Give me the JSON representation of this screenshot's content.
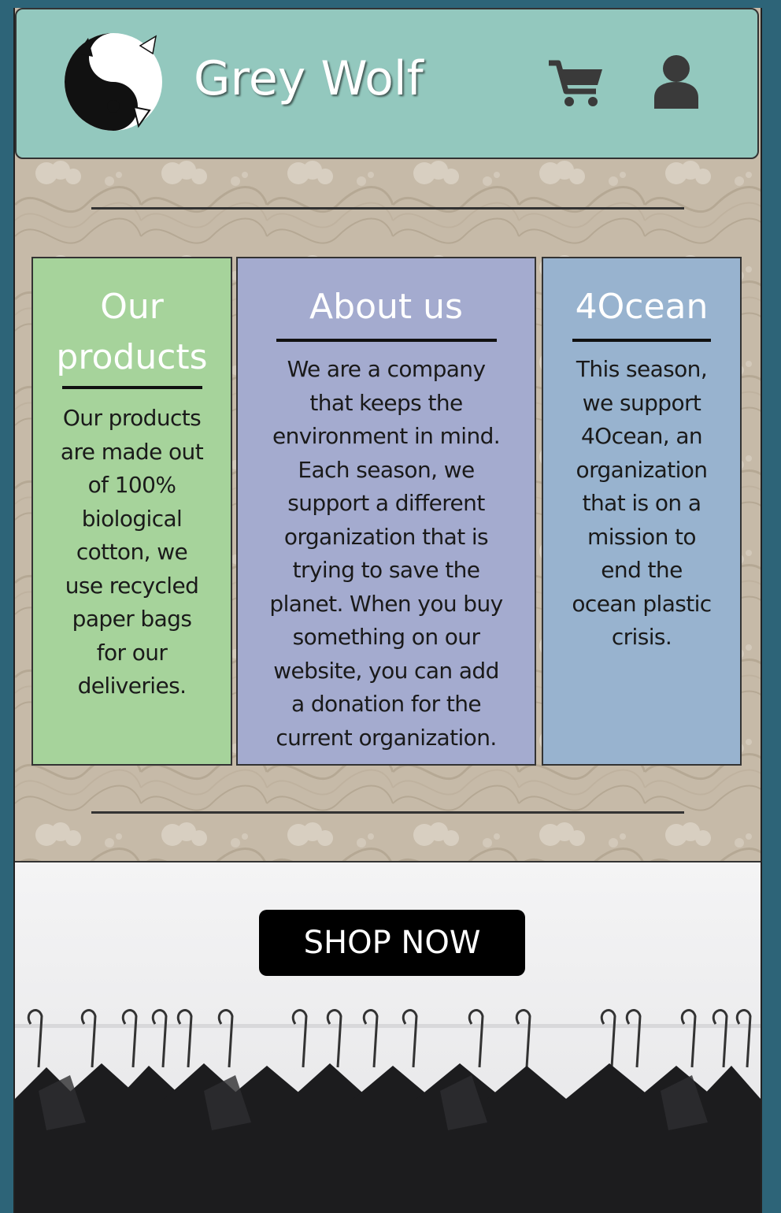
{
  "header": {
    "brand": "Grey Wolf",
    "icons": [
      "wolf-logo-icon",
      "cart-icon",
      "user-icon"
    ]
  },
  "cards": [
    {
      "title": "Our products",
      "text_lines": [
        "Our products",
        "are made out",
        "of 100%",
        "biological",
        "cotton, we",
        "use recycled",
        "paper bags",
        "for our",
        "deliveries."
      ],
      "color": "#a6d39b"
    },
    {
      "title": "About us",
      "text_lines": [
        "We are a company",
        "that keeps the",
        "environment in mind.",
        "Each season, we",
        "support a different",
        "organization that is",
        "trying to save the",
        "planet. When you buy",
        "something on our",
        "website, you can add",
        "a donation for the",
        "current organization."
      ],
      "color": "#a4abcf"
    },
    {
      "title": "4Ocean",
      "text_lines": [
        "This season,",
        "we support",
        "4Ocean, an",
        "organization",
        "that is on a",
        "mission to",
        "end the",
        "ocean plastic",
        "crisis."
      ],
      "color": "#98b3cf"
    }
  ],
  "hero": {
    "button_label": "SHOP NOW"
  },
  "colors": {
    "header_bg": "#93c8be",
    "page_bg": "#2d6478",
    "pattern_bg": "#c6baa8",
    "button_bg": "#000000"
  }
}
